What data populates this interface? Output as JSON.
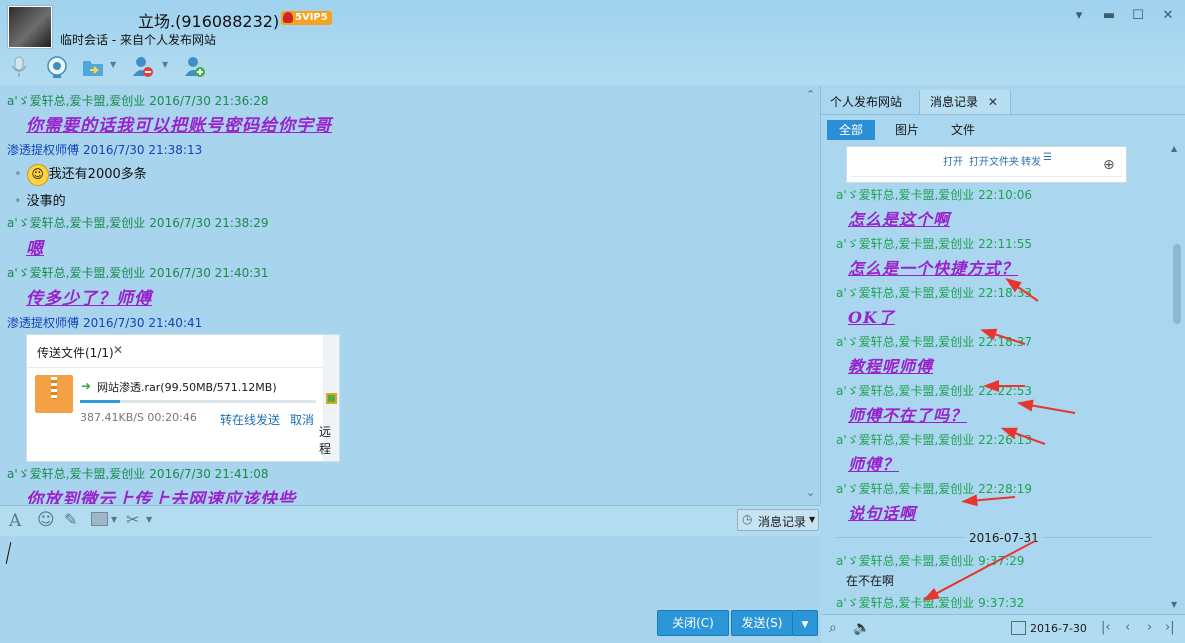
{
  "window": {
    "title": "立场.(916088232)",
    "vip_badge": "5VIP5",
    "subtitle": "临时会话 - 来自个人发布网站",
    "buttons": {
      "dropdown": "▾",
      "minimize": "▬",
      "maximize": "☐",
      "close": "✕"
    }
  },
  "toolbar_icons": [
    "microphone-icon",
    "video-icon",
    "file-transfer-icon",
    "remove-contact-icon",
    "add-contact-icon"
  ],
  "chat": {
    "messages": [
      {
        "sender": "a'ゞ爱轩总,爱卡盟,爱创业",
        "time": "2016/7/30 21:36:28",
        "text": "你需要的话我可以把账号密码给你宇哥",
        "style": "big"
      },
      {
        "sender": "渗透提权师傅",
        "time": "2016/7/30 21:38:13",
        "lines": [
          "我还有2000多条",
          "没事的"
        ],
        "style": "plain"
      },
      {
        "sender": "a'ゞ爱轩总,爱卡盟,爱创业",
        "time": "2016/7/30 21:38:29",
        "text": "嗯",
        "style": "big"
      },
      {
        "sender": "a'ゞ爱轩总,爱卡盟,爱创业",
        "time": "2016/7/30 21:40:31",
        "text": "传多少了？师傅",
        "style": "big"
      },
      {
        "sender": "渗透提权师傅",
        "time": "2016/7/30 21:40:41",
        "style": "card"
      },
      {
        "sender": "a'ゞ爱轩总,爱卡盟,爱创业",
        "time": "2016/7/30 21:41:08",
        "text": "你放到微云上传上去网速应该快些",
        "style": "big"
      }
    ],
    "transfer": {
      "title": "传送文件(1/1)",
      "filename": "网站渗透.rar(99.50MB/571.12MB)",
      "progress": 0.17,
      "speed": "387.41KB/S 00:20:46",
      "offline_label": "转在线发送",
      "cancel_label": "取消",
      "partial_text": "远程"
    }
  },
  "input": {
    "history_label": "消息记录",
    "close_label": "关闭(C)",
    "send_label": "发送(S)"
  },
  "right": {
    "tabs": [
      "个人发布网站",
      "消息记录"
    ],
    "filters": [
      "全部",
      "图片",
      "文件"
    ],
    "preview_actions": [
      "打开",
      "打开文件夹",
      "转发"
    ],
    "messages": [
      {
        "sender": "a'ゞ爱轩总,爱卡盟,爱创业",
        "time": "22:10:06",
        "text": "怎么是这个啊",
        "style": "big"
      },
      {
        "sender": "a'ゞ爱轩总,爱卡盟,爱创业",
        "time": "22:11:55",
        "text": "怎么是一个快捷方式？",
        "style": "big"
      },
      {
        "sender": "a'ゞ爱轩总,爱卡盟,爱创业",
        "time": "22:18:33",
        "text": "OK了",
        "style": "big"
      },
      {
        "sender": "a'ゞ爱轩总,爱卡盟,爱创业",
        "time": "22:18:37",
        "text": "教程呢师傅",
        "style": "big"
      },
      {
        "sender": "a'ゞ爱轩总,爱卡盟,爱创业",
        "time": "22:22:53",
        "text": "师傅不在了吗？",
        "style": "big"
      },
      {
        "sender": "a'ゞ爱轩总,爱卡盟,爱创业",
        "time": "22:26:13",
        "text": "师傅？",
        "style": "big"
      },
      {
        "sender": "a'ゞ爱轩总,爱卡盟,爱创业",
        "time": "22:28:19",
        "text": "说句话啊",
        "style": "big"
      }
    ],
    "date_divider": "2016-07-31",
    "after": [
      {
        "sender": "a'ゞ爱轩总,爱卡盟,爱创业",
        "time": "9:37:29",
        "text": "在不在啊",
        "style": "plain"
      },
      {
        "sender": "a'ゞ爱轩总,爱卡盟,爱创业",
        "time": "9:37:32",
        "text": "",
        "style": "plain"
      }
    ],
    "bottom_date": "2016-7-30"
  },
  "colors": {
    "purple_text": "#9a22cc",
    "green_sender": "#1a8a4c",
    "blue_sender": "#1642b8",
    "accent": "#2c97d8",
    "arrow": "#e8352e"
  }
}
